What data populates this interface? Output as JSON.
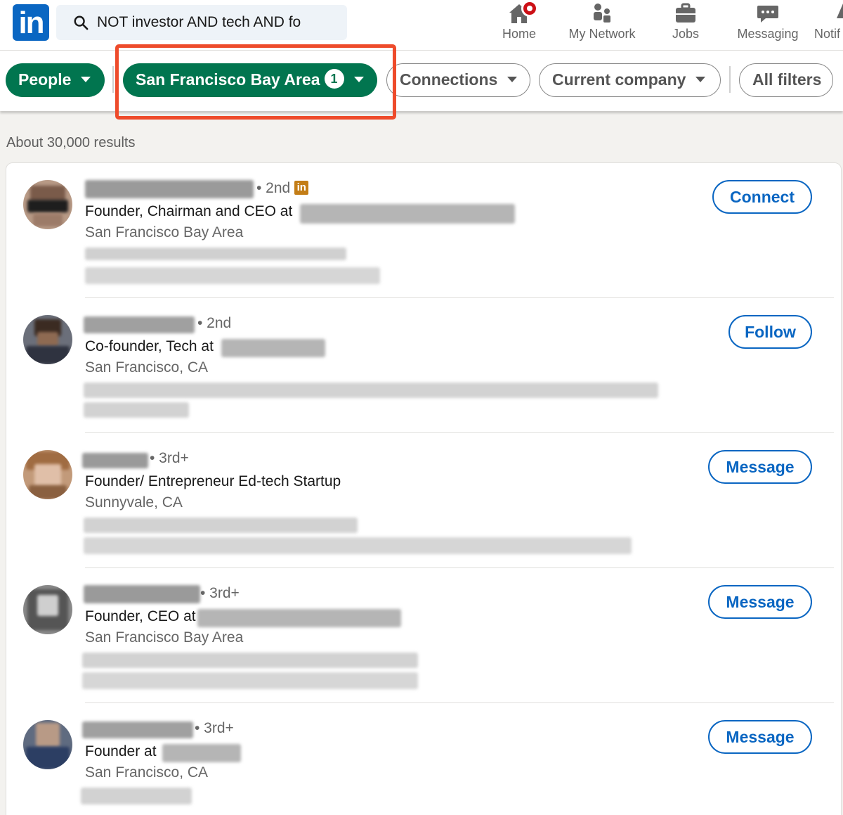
{
  "nav": {
    "search_value": "NOT investor AND tech AND fo",
    "items": [
      {
        "label": "Home",
        "icon": "home-icon"
      },
      {
        "label": "My Network",
        "icon": "network-icon"
      },
      {
        "label": "Jobs",
        "icon": "briefcase-icon"
      },
      {
        "label": "Messaging",
        "icon": "messaging-icon"
      },
      {
        "label": "Notif",
        "icon": "bell-icon"
      }
    ],
    "logo_text": "in"
  },
  "filters": {
    "people": "People",
    "location": "San Francisco Bay Area",
    "location_count": "1",
    "connections": "Connections",
    "current_company": "Current company",
    "all_filters": "All filters"
  },
  "results": {
    "count_text": "About 30,000 results",
    "items": [
      {
        "degree": "• 2nd",
        "headline": "Founder, Chairman and CEO at",
        "location": "San Francisco Bay Area",
        "action": "Connect",
        "premium": true
      },
      {
        "degree": "• 2nd",
        "headline": "Co-founder, Tech at",
        "location": "San Francisco, CA",
        "action": "Follow",
        "premium": false
      },
      {
        "degree": "• 3rd+",
        "headline": "Founder/ Entrepreneur Ed-tech Startup",
        "location": "Sunnyvale, CA",
        "action": "Message",
        "premium": false
      },
      {
        "degree": "• 3rd+",
        "headline": "Founder, CEO at",
        "location": "San Francisco Bay Area",
        "action": "Message",
        "premium": false
      },
      {
        "degree": "• 3rd+",
        "headline": "Founder at",
        "location": "San Francisco, CA",
        "action": "Message",
        "premium": false
      }
    ]
  },
  "colors": {
    "brand": "#0a66c2",
    "filter_active": "#01754f",
    "highlight": "#ee4b2b",
    "premium_badge": "#c37d16"
  }
}
